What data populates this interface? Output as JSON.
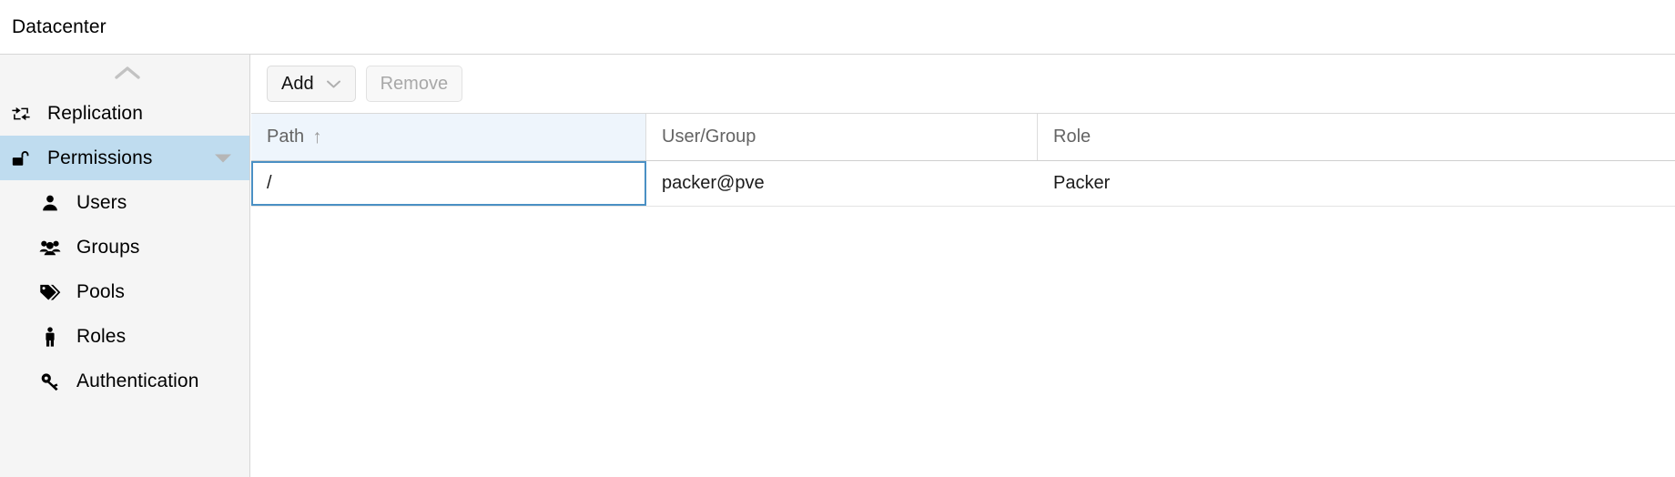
{
  "header": {
    "title": "Datacenter"
  },
  "sidebar": {
    "collapse_icon": "chevron-up-icon",
    "items": [
      {
        "label": "Replication",
        "icon": "replication-icon",
        "level": 1,
        "selected": false,
        "expandable": false
      },
      {
        "label": "Permissions",
        "icon": "unlock-icon",
        "level": 1,
        "selected": true,
        "expandable": true
      },
      {
        "label": "Users",
        "icon": "user-icon",
        "level": 2,
        "selected": false,
        "expandable": false
      },
      {
        "label": "Groups",
        "icon": "users-group-icon",
        "level": 2,
        "selected": false,
        "expandable": false
      },
      {
        "label": "Pools",
        "icon": "tags-icon",
        "level": 2,
        "selected": false,
        "expandable": false
      },
      {
        "label": "Roles",
        "icon": "person-figure-icon",
        "level": 2,
        "selected": false,
        "expandable": false
      },
      {
        "label": "Authentication",
        "icon": "key-icon",
        "level": 2,
        "selected": false,
        "expandable": false
      }
    ]
  },
  "toolbar": {
    "add_label": "Add",
    "add_caret_icon": "chevron-down-icon",
    "remove_label": "Remove",
    "remove_disabled": true
  },
  "grid": {
    "columns": [
      {
        "label": "Path",
        "sorted": true,
        "sort_dir": "asc",
        "sort_glyph": "↑"
      },
      {
        "label": "User/Group",
        "sorted": false,
        "sort_dir": "",
        "sort_glyph": ""
      },
      {
        "label": "Role",
        "sorted": false,
        "sort_dir": "",
        "sort_glyph": ""
      }
    ],
    "rows": [
      {
        "path": "/",
        "user_group": "packer@pve",
        "role": "Packer",
        "focused_cell": "path"
      }
    ]
  },
  "colors": {
    "selection_blue": "#bfdcef",
    "focus_border": "#4a90c4",
    "sorted_header": "#eef5fc",
    "sidebar_bg": "#f5f5f5"
  }
}
